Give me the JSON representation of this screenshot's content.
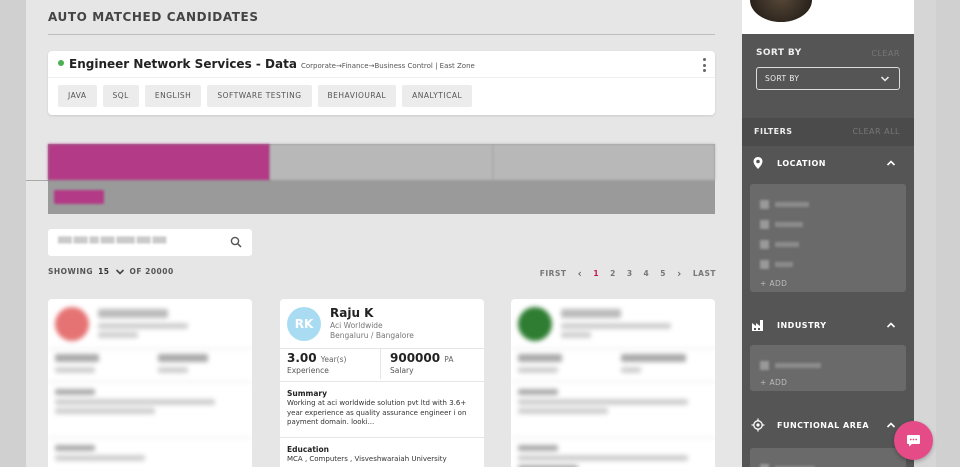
{
  "page_title": "AUTO MATCHED CANDIDATES",
  "job": {
    "title": "Engineer Network Services - Data",
    "path": "Corporate→Finance→Business Control | East Zone",
    "skills": [
      "JAVA",
      "SQL",
      "ENGLISH",
      "SOFTWARE TESTING",
      "BEHAVIOURAL",
      "ANALYTICAL"
    ]
  },
  "listing": {
    "showing_label": "SHOWING",
    "count": "15",
    "of_label": "OF 20000",
    "pager": {
      "first": "FIRST",
      "prev": "‹",
      "pages": [
        "1",
        "2",
        "3",
        "4",
        "5"
      ],
      "next": "›",
      "last": "LAST",
      "current": "1"
    }
  },
  "candidate": {
    "initials": "RK",
    "name": "Raju K",
    "company": "Aci Worldwide",
    "location": "Bengaluru / Bangalore",
    "experience_value": "3.00",
    "experience_unit": "Year(s)",
    "experience_label": "Experience",
    "salary_value": "900000",
    "salary_unit": "PA",
    "salary_label": "Salary",
    "summary_title": "Summary",
    "summary_text": "Working at aci worldwide solution pvt ltd with 3.6+ year experience as quality assurance engineer i on payment domain. looki...",
    "education_title": "Education",
    "education_text": "MCA , Computers , Visveshwaraiah University"
  },
  "sidebar": {
    "sort_by_label": "SORT BY",
    "sort_clear": "CLEAR",
    "sort_select_value": "SORT BY",
    "filters_label": "FILTERS",
    "filters_clear": "CLEAR ALL",
    "sections": [
      {
        "label": "LOCATION",
        "add": "+ ADD",
        "icon": "location-pin-icon"
      },
      {
        "label": "INDUSTRY",
        "add": "+ ADD",
        "icon": "factory-icon"
      },
      {
        "label": "FUNCTIONAL AREA",
        "icon": "target-icon"
      }
    ]
  },
  "colors": {
    "accent": "#b23a86",
    "chat": "#e54b86",
    "status_dot": "#4caf50",
    "avatar_rk": "#a9dcf2",
    "avatar_blur_left": "#e57373",
    "avatar_blur_right": "#2e7d32"
  }
}
